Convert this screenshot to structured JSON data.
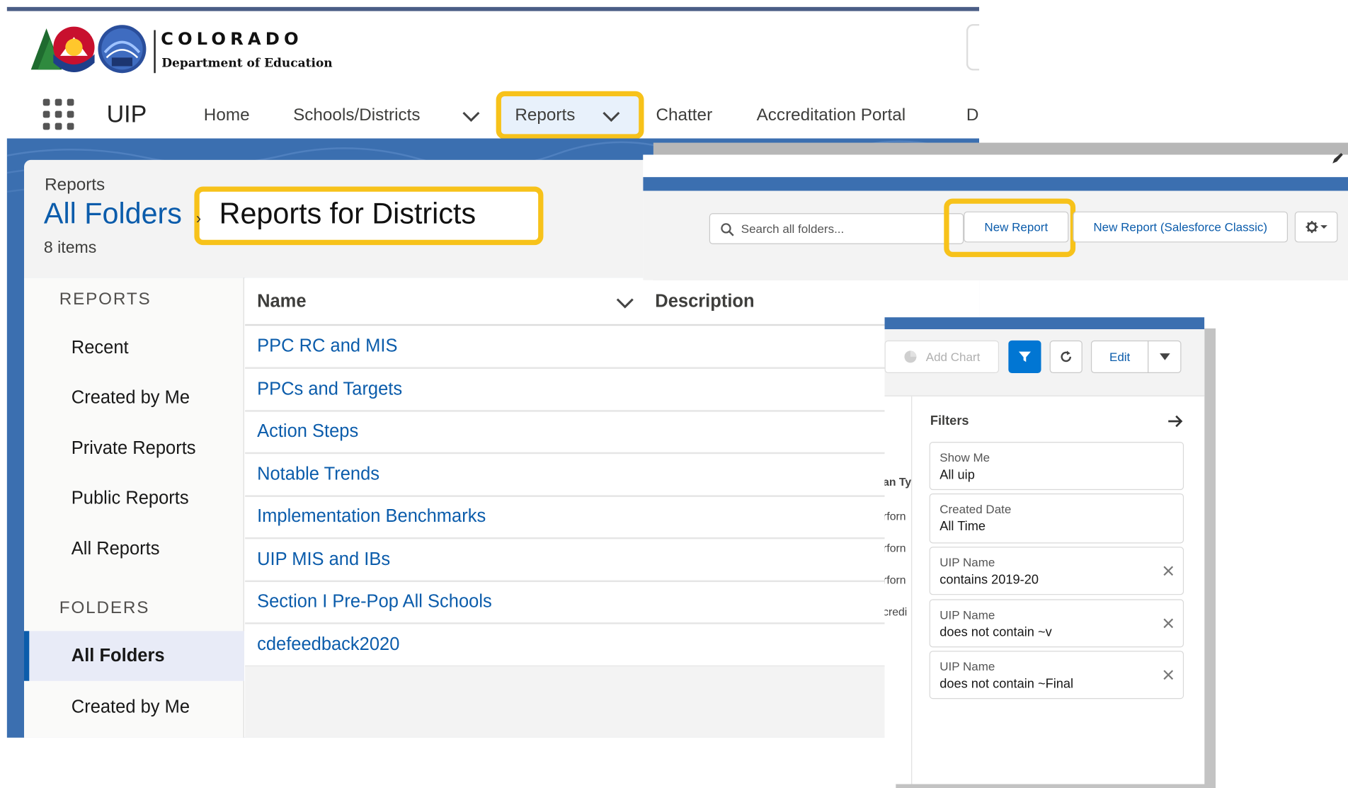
{
  "brand": {
    "org_title": "COLORADO",
    "org_subtitle": "Department of Education",
    "logo_badge": "CDE"
  },
  "nav": {
    "app_name": "UIP",
    "items": [
      {
        "label": "Home"
      },
      {
        "label": "Schools/Districts"
      },
      {
        "label": "Reports"
      },
      {
        "label": "Chatter"
      },
      {
        "label": "Accreditation Portal"
      },
      {
        "label": "D"
      }
    ]
  },
  "header": {
    "section_label": "Reports",
    "breadcrumb_link": "All Folders",
    "separator": "›",
    "folder_title": "Reports for Districts",
    "item_count": "8 items"
  },
  "sidebar": {
    "reports_heading": "REPORTS",
    "report_items": [
      {
        "label": "Recent"
      },
      {
        "label": "Created by Me"
      },
      {
        "label": "Private Reports"
      },
      {
        "label": "Public Reports"
      },
      {
        "label": "All Reports"
      }
    ],
    "folders_heading": "FOLDERS",
    "folder_items": [
      {
        "label": "All Folders",
        "active": true
      },
      {
        "label": "Created by Me"
      }
    ]
  },
  "table": {
    "columns": [
      "Name",
      "Description"
    ],
    "rows": [
      {
        "name": "PPC RC and MIS"
      },
      {
        "name": "PPCs and Targets"
      },
      {
        "name": "Action Steps"
      },
      {
        "name": "Notable Trends"
      },
      {
        "name": "Implementation Benchmarks"
      },
      {
        "name": "UIP MIS and IBs"
      },
      {
        "name": "Section I Pre-Pop All Schools"
      },
      {
        "name": "cdefeedback2020"
      }
    ]
  },
  "folder_actions": {
    "search_placeholder": "Search all folders...",
    "new_report": "New Report",
    "new_report_classic": "New Report (Salesforce Classic)"
  },
  "report_toolbar": {
    "add_chart": "Add Chart",
    "edit": "Edit"
  },
  "partial_column": {
    "header": "an Ty",
    "cells": [
      "rforn",
      "rforn",
      "rforn",
      "credi"
    ]
  },
  "filters": {
    "title": "Filters",
    "items": [
      {
        "label": "Show Me",
        "value": "All uip",
        "removable": false
      },
      {
        "label": "Created Date",
        "value": "All Time",
        "removable": false
      },
      {
        "label": "UIP Name",
        "value": "contains 2019-20",
        "removable": true
      },
      {
        "label": "UIP Name",
        "value": "does not contain ~v",
        "removable": true
      },
      {
        "label": "UIP Name",
        "value": "does not contain ~Final",
        "removable": true
      }
    ]
  },
  "colors": {
    "brand_blue": "#0b5cab",
    "banner_blue": "#3b6fb0",
    "highlight": "#f7c21a",
    "filter_button": "#0176d3"
  }
}
